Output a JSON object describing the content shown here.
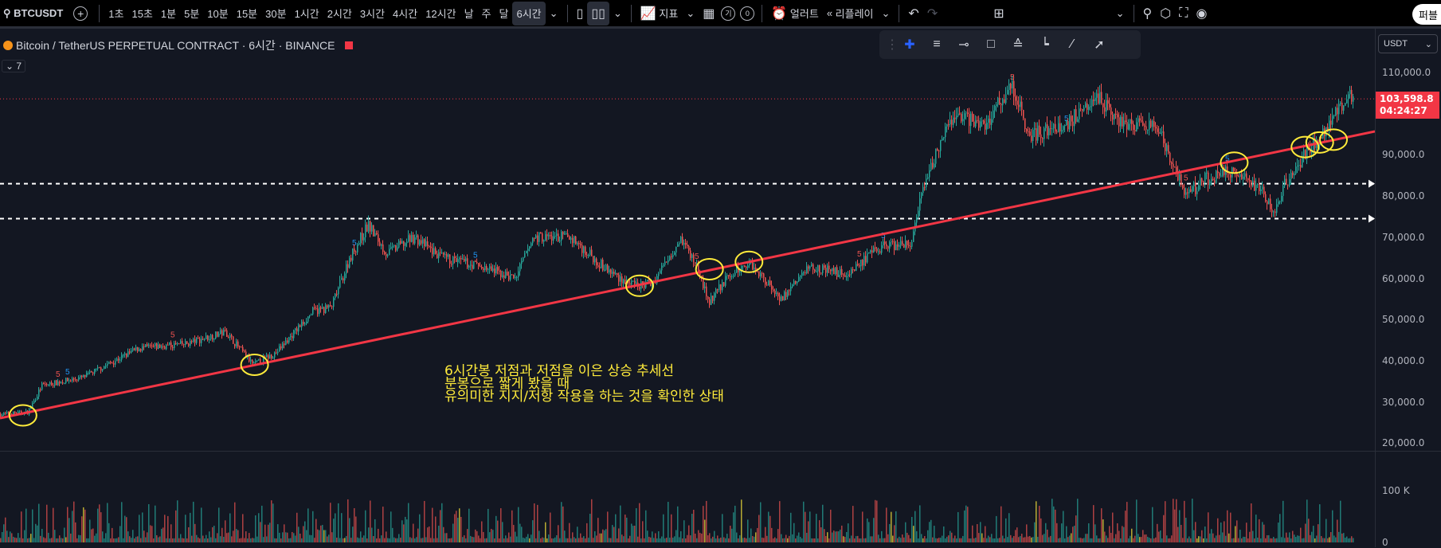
{
  "toolbar": {
    "symbol": "BTCUSDT",
    "intervals": [
      "1초",
      "15초",
      "1분",
      "5분",
      "10분",
      "15분",
      "30분",
      "1시간",
      "2시간",
      "3시간",
      "4시간",
      "12시간",
      "날",
      "주",
      "달"
    ],
    "active_interval": "6시간",
    "indicators_label": "지표",
    "badge_a": "기",
    "badge_b": "0",
    "alert_label": "얼러트",
    "replay_label": "리플레이",
    "publish_label": "퍼블"
  },
  "chart": {
    "title": "Bitcoin / TetherUS PERPETUAL CONTRACT · 6시간 · BINANCE",
    "legend_count": "7",
    "currency": "USDT",
    "price_labels": [
      "110,000.0",
      "90,000.0",
      "80,000.0",
      "70,000.0",
      "60,000.0",
      "50,000.0",
      "40,000.0",
      "30,000.0",
      "20,000.0"
    ],
    "current_price": "103,598.8",
    "countdown": "04:24:27",
    "volume_labels": [
      "100 K",
      "0"
    ],
    "horizontal_levels": [
      83000,
      74500
    ],
    "annotation": [
      "6시간봉 저점과 저점을 이은 상승 추세선",
      "분봉으로 짧게 봤을 때",
      "유의미한 지지/저항 작용을 하는 것을 확인한 상태"
    ],
    "colors": {
      "up": "#26a69a",
      "down": "#ef5350",
      "trendline": "#f23645",
      "annotation": "#ffeb3b",
      "marker": "#2962ff"
    }
  }
}
